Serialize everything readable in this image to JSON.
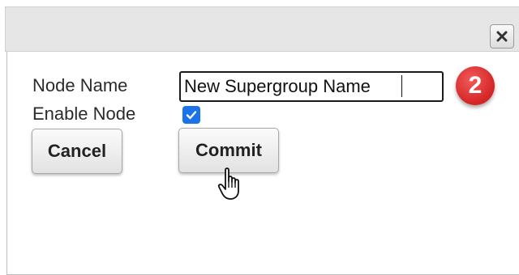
{
  "form": {
    "node_name_label": "Node Name",
    "node_name_value": "New Supergroup Name",
    "enable_node_label": "Enable Node",
    "enable_node_checked": true
  },
  "buttons": {
    "cancel_label": "Cancel",
    "commit_label": "Commit"
  },
  "annotation": {
    "step_number": "2",
    "badge_color": "#e03a3a"
  },
  "icons": {
    "close": "close-icon",
    "checkbox": "checkmark-icon",
    "cursor": "hand-pointer-icon"
  },
  "colors": {
    "checkbox_accent": "#1a73e8",
    "titlebar_bg": "#e6e6e6"
  }
}
